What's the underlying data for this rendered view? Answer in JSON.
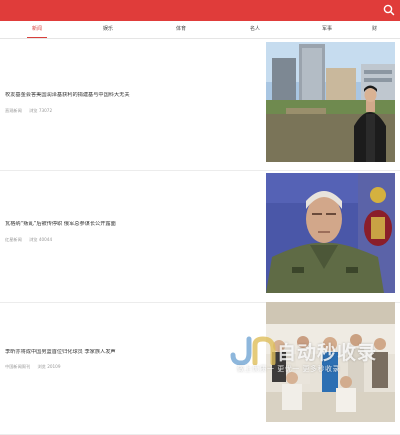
{
  "header": {
    "search_icon": "search-icon",
    "accent_color": "#e03c3a"
  },
  "tabs": [
    {
      "label": "新闻",
      "active": true
    },
    {
      "label": "娱乐",
      "active": false
    },
    {
      "label": "体育",
      "active": false
    },
    {
      "label": "名人",
      "active": false
    },
    {
      "label": "军事",
      "active": false
    },
    {
      "label": "财",
      "active": false
    }
  ],
  "articles": [
    {
      "title": "校友基金会答美国润泽基获利的捐建基与中国科大无关",
      "source": "直观新闻",
      "views": "浏览 73072",
      "thumb_alt": "站在城市楼群前的男子"
    },
    {
      "title": "瓦格纳“叛乱”后被传停职 俄军总参谋长公开露面",
      "source": "红星新闻",
      "views": "浏览 40044",
      "thumb_alt": "身着军装的俄军将领"
    },
    {
      "title": "李昕亦将成中国男篮首位归化球员 李家族人发声",
      "source": "中国新闻周刊",
      "views": "浏览 20109",
      "thumb_alt": "室内一群人的合影"
    }
  ],
  "watermark": {
    "title": "自动秒收录",
    "subtitle": "做上优质一 更优一 更多秒收录"
  }
}
